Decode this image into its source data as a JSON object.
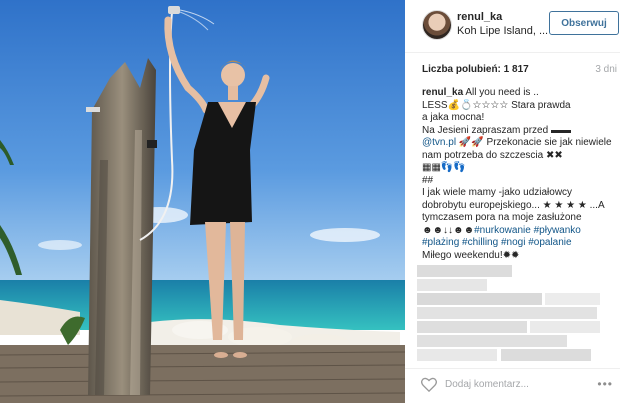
{
  "post": {
    "username": "renul_ka",
    "location": "Koh Lipe Island, ...",
    "follow_label": "Obserwuj",
    "likes_text": "Liczba polubień: 1 817",
    "time_ago": "3 dni"
  },
  "caption": {
    "line1": "All you need is ..",
    "line2": "LESS💰💍☆☆☆☆ Stara prawda",
    "line3": "a jaka mocna!",
    "line4": "Na Jesieni zapraszam przed ▬▬",
    "line5a": "@tvn.pl",
    "line5b": "🚀🚀 Przekonacie sie jak niewiele",
    "line6": "nam potrzeba do szczescia ✖✖",
    "line7": "▦▦👣👣",
    "line8": "##",
    "line9": "I jak wiele mamy -jako udziałowcy",
    "line10": "dobrobytu europejskiego... ★ ★ ★ ★ ...A",
    "line11": "tymczasem pora na moje zasłużone",
    "line12a": "☻☻↓↓☻☻",
    "line12b": "#nurkowanie",
    "line12c": "#pływanko",
    "line13a": "#plażing",
    "line13b": "#chilling",
    "line13c": "#nogi",
    "line13d": "#opalanie",
    "line14": "Miłego weekendu!✹✹"
  },
  "footer": {
    "comment_placeholder": "Dodaj komentarz...",
    "more_label": "•••",
    "heart_icon": "heart-outline-icon"
  },
  "colors": {
    "link": "#125688",
    "follow": "#3f729b",
    "muted": "#a5a7aa"
  }
}
